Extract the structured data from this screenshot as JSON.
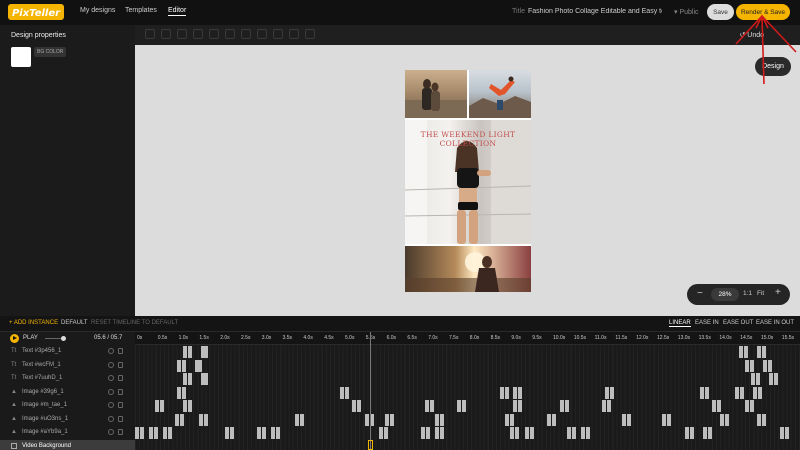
{
  "app": {
    "logo_text": "PixTeller",
    "nav": [
      "My designs",
      "Templates",
      "Editor"
    ],
    "active_nav": "Editor"
  },
  "header": {
    "title_label": "Title",
    "title_value": "Fashion Photo Collage Editable and Easy to Us",
    "visibility": "Public",
    "save_label": "Save",
    "render_label": "Render & Save"
  },
  "left_panel": {
    "title": "Design properties",
    "bg_color_label": "BG COLOR",
    "bg_color": "#ffffff"
  },
  "toolbar": {
    "undo_label": "Undo",
    "design_label": "Design"
  },
  "collage": {
    "headline": "THE WEEKEND LIGHT COLLECTION"
  },
  "zoom": {
    "minus": "−",
    "value": "28%",
    "ratio": "1:1",
    "fit": "Fit",
    "plus": "+"
  },
  "timeline": {
    "add_instance": "+ ADD INSTANCE",
    "default": "DEFAULT",
    "reset": "RESET TIMELINE TO DEFAULT",
    "ease": [
      "LINEAR",
      "EASE IN",
      "EASE OUT",
      "EASE IN OUT"
    ],
    "active_ease": "LINEAR",
    "play_label": "PLAY",
    "time_readout": "05.6 / 05.7",
    "ruler": [
      "0s",
      "0.5s",
      "1.0s",
      "1.5s",
      "2.0s",
      "2.5s",
      "3.0s",
      "3.5s",
      "4.0s",
      "4.5s",
      "5.0s",
      "5.5s",
      "6.0s",
      "6.5s",
      "7.0s",
      "7.5s",
      "8.0s",
      "8.5s",
      "9.0s",
      "9.5s",
      "10.0s",
      "10.5s",
      "11.0s",
      "11.5s",
      "12.0s",
      "12.5s",
      "13.0s",
      "13.5s",
      "14.0s",
      "14.5s",
      "15.0s",
      "15.5s"
    ],
    "layers": [
      {
        "type": "Tt",
        "name": "Text #3p456_1",
        "icon": "text-icon"
      },
      {
        "type": "Tt",
        "name": "Text #wcFM_1",
        "icon": "text-icon"
      },
      {
        "type": "Tt",
        "name": "Text #7uuhD_1",
        "icon": "text-icon"
      },
      {
        "type": "img",
        "name": "Image #39g6_1",
        "icon": "image-icon"
      },
      {
        "type": "img",
        "name": "Image #m_tae_1",
        "icon": "image-icon"
      },
      {
        "type": "img",
        "name": "Image #uO3ns_1",
        "icon": "image-icon"
      },
      {
        "type": "img",
        "name": "Image #aYb9a_1",
        "icon": "image-icon"
      },
      {
        "type": "bg",
        "name": "Video Background",
        "icon": "square-icon"
      }
    ],
    "selected_layer": "Video Background"
  },
  "colors": {
    "accent": "#f5b400",
    "annotation": "#d11a1a"
  }
}
